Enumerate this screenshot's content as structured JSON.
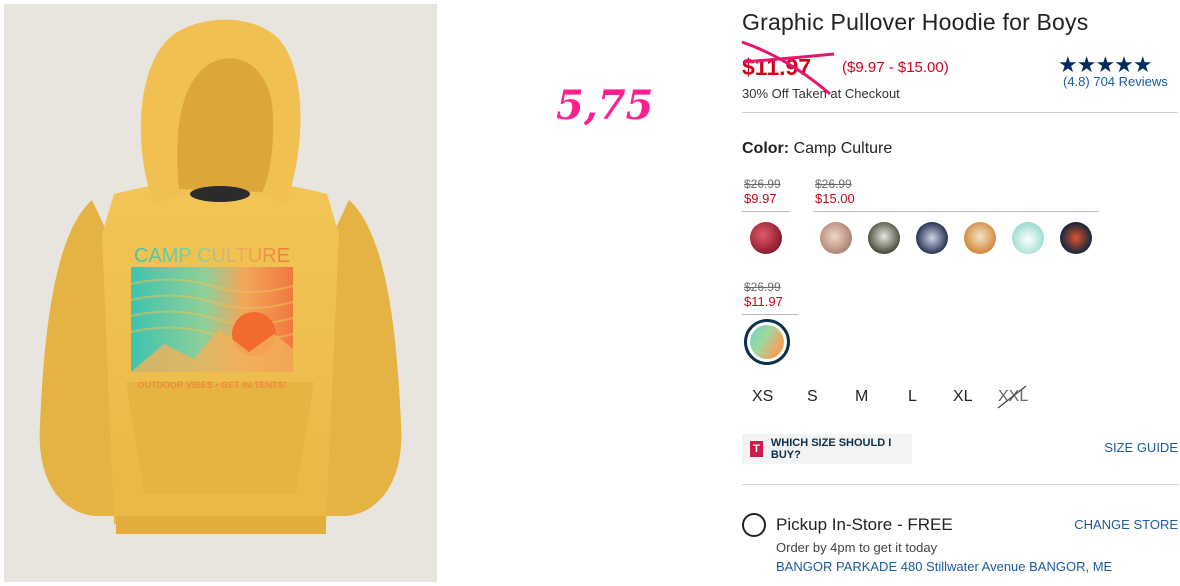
{
  "overlay": {
    "annotation": "5,75"
  },
  "product": {
    "title": "Graphic Pullover Hoodie for Boys",
    "sale_price": "$11.97",
    "price_range": "($9.97 - $15.00)",
    "promo": "30% Off Taken at Checkout",
    "rating": {
      "stars": "★★★★★",
      "text": "(4.8) 704 Reviews",
      "value": 4.8
    },
    "image_print": {
      "headline": "CAMP CULTURE",
      "tagline": "OUTDOOR VIBES • GET IN-TENTS!"
    }
  },
  "color": {
    "label": "Color:",
    "value": "Camp Culture",
    "price_groups": [
      {
        "old": "$26.99",
        "new": "$9.97"
      },
      {
        "old": "$26.99",
        "new": "$15.00"
      },
      {
        "old": "$26.99",
        "new": "$11.97"
      }
    ]
  },
  "sizes": [
    "XS",
    "S",
    "M",
    "L",
    "XL",
    "XXL"
  ],
  "fit": {
    "logo": "T",
    "text": "WHICH SIZE SHOULD I BUY?"
  },
  "size_guide": "SIZE GUIDE",
  "pickup": {
    "label": "Pickup In-Store - FREE",
    "change_store": "CHANGE STORE",
    "order_by": "Order by 4pm to get it today",
    "address": "BANGOR PARKADE 480 Stillwater Avenue  BANGOR, ME"
  },
  "colors": {
    "sale": "#d0021b",
    "navy": "#0c2f4a",
    "link": "#1a5aa0",
    "overlay": "#ff1f8e",
    "hoodie": "#efbf4d"
  }
}
